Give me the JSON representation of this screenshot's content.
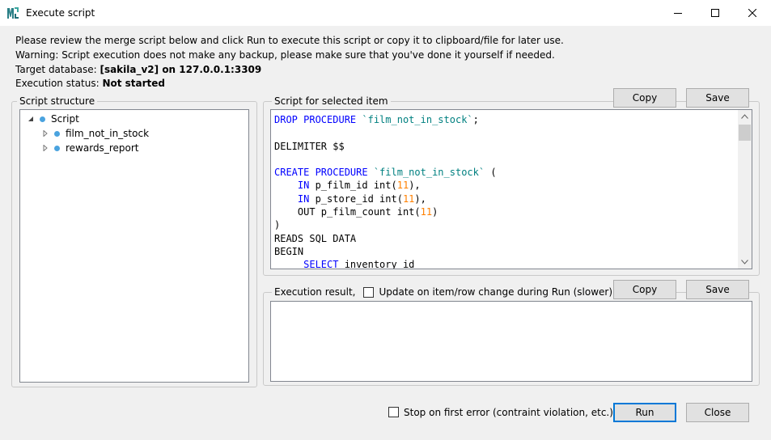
{
  "window": {
    "title": "Execute script"
  },
  "info": {
    "line1": "Please review the merge script below and click Run to execute this script or copy it to clipboard/file for later use.",
    "line2": "Warning: Script execution does not make any backup, please make sure that you've done it yourself if needed.",
    "target_label": "Target database:",
    "target_value": "[sakila_v2] on 127.0.0.1:3309",
    "status_label": "Execution status:",
    "status_value": "Not started"
  },
  "structure": {
    "legend": "Script structure",
    "root": "Script",
    "children": [
      "film_not_in_stock",
      "rewards_report"
    ]
  },
  "script_panel": {
    "legend": "Script for selected item",
    "copy_label": "Copy",
    "save_label": "Save",
    "lines": [
      [
        {
          "t": "DROP PROCEDURE ",
          "c": "kw"
        },
        {
          "t": "`film_not_in_stock`",
          "c": "id"
        },
        {
          "t": ";",
          "c": ""
        }
      ],
      [],
      [
        {
          "t": "DELIMITER $$",
          "c": ""
        }
      ],
      [],
      [
        {
          "t": "CREATE PROCEDURE ",
          "c": "kw"
        },
        {
          "t": "`film_not_in_stock`",
          "c": "id"
        },
        {
          "t": " (",
          "c": ""
        }
      ],
      [
        {
          "t": "    ",
          "c": ""
        },
        {
          "t": "IN",
          "c": "kw"
        },
        {
          "t": " p_film_id int(",
          "c": ""
        },
        {
          "t": "11",
          "c": "num"
        },
        {
          "t": "),",
          "c": ""
        }
      ],
      [
        {
          "t": "    ",
          "c": ""
        },
        {
          "t": "IN",
          "c": "kw"
        },
        {
          "t": " p_store_id int(",
          "c": ""
        },
        {
          "t": "11",
          "c": "num"
        },
        {
          "t": "),",
          "c": ""
        }
      ],
      [
        {
          "t": "    OUT p_film_count int(",
          "c": ""
        },
        {
          "t": "11",
          "c": "num"
        },
        {
          "t": ")",
          "c": ""
        }
      ],
      [
        {
          "t": ")",
          "c": ""
        }
      ],
      [
        {
          "t": "READS SQL DATA",
          "c": ""
        }
      ],
      [
        {
          "t": "BEGIN",
          "c": ""
        }
      ],
      [
        {
          "t": "     ",
          "c": ""
        },
        {
          "t": "SELECT",
          "c": "kw"
        },
        {
          "t": " inventory_id",
          "c": ""
        }
      ]
    ]
  },
  "result_panel": {
    "legend": "Execution result,",
    "update_label": "Update on item/row change during Run (slower)",
    "copy_label": "Copy",
    "save_label": "Save"
  },
  "footer": {
    "stop_label": "Stop on first error (contraint violation, etc.)",
    "run_label": "Run",
    "close_label": "Close"
  }
}
